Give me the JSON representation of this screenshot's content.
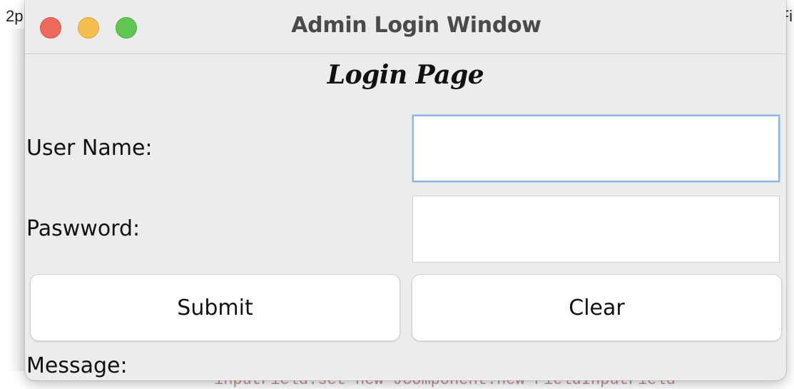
{
  "background": {
    "left_text": "2p",
    "right_text": "Fi",
    "code_text": "inputField.set    new JComponent.new FieldInputField"
  },
  "window": {
    "title": "Admin Login Window",
    "controls": {
      "close_color": "#ed6a5e",
      "minimize_color": "#f5bf4f",
      "maximize_color": "#61c554"
    }
  },
  "form": {
    "heading": "Login Page",
    "username_label": "User Name:",
    "username_value": "",
    "password_label": "Paswword:",
    "password_value": "",
    "submit_label": "Submit",
    "clear_label": "Clear",
    "message_label": "Message:"
  },
  "colors": {
    "window_bg": "#ececec",
    "focus_ring": "#8db6e6"
  }
}
